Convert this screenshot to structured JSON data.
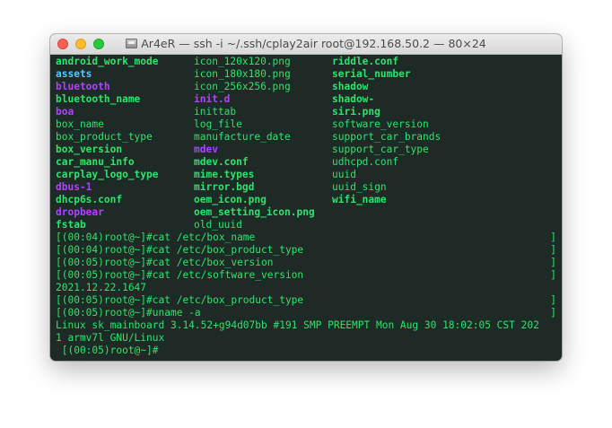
{
  "window": {
    "title": "Ar4eR — ssh -i ~/.ssh/cplay2air root@192.168.50.2 — 80×24",
    "title_icon": "disk-icon"
  },
  "colors": {
    "background": "#1d2a26",
    "text": "#2fe26b",
    "executable": "#56c6ff",
    "directory": "#b042ff"
  },
  "listing": [
    [
      {
        "text": "android_work_mode",
        "style": "bold green"
      },
      {
        "text": "icon_120x120.png",
        "style": "green"
      },
      {
        "text": "riddle.conf",
        "style": "bold green"
      }
    ],
    [
      {
        "text": "assets",
        "style": "bold cyan"
      },
      {
        "text": "icon_180x180.png",
        "style": "green"
      },
      {
        "text": "serial_number",
        "style": "bold green"
      }
    ],
    [
      {
        "text": "bluetooth",
        "style": "bold purple"
      },
      {
        "text": "icon_256x256.png",
        "style": "green"
      },
      {
        "text": "shadow",
        "style": "bold green"
      }
    ],
    [
      {
        "text": "bluetooth_name",
        "style": "bold green"
      },
      {
        "text": "init.d",
        "style": "bold purple"
      },
      {
        "text": "shadow-",
        "style": "bold green"
      }
    ],
    [
      {
        "text": "boa",
        "style": "bold purple"
      },
      {
        "text": "inittab",
        "style": "green"
      },
      {
        "text": "siri.png",
        "style": "bold green"
      }
    ],
    [
      {
        "text": "box_name",
        "style": "green"
      },
      {
        "text": "log_file",
        "style": "green"
      },
      {
        "text": "software_version",
        "style": "green"
      }
    ],
    [
      {
        "text": "box_product_type",
        "style": "green"
      },
      {
        "text": "manufacture_date",
        "style": "green"
      },
      {
        "text": "support_car_brands",
        "style": "green"
      }
    ],
    [
      {
        "text": "box_version",
        "style": "bold green"
      },
      {
        "text": "mdev",
        "style": "bold purple"
      },
      {
        "text": "support_car_type",
        "style": "green"
      }
    ],
    [
      {
        "text": "car_manu_info",
        "style": "bold green"
      },
      {
        "text": "mdev.conf",
        "style": "bold green"
      },
      {
        "text": "udhcpd.conf",
        "style": "green"
      }
    ],
    [
      {
        "text": "carplay_logo_type",
        "style": "bold green"
      },
      {
        "text": "mime.types",
        "style": "bold green"
      },
      {
        "text": "uuid",
        "style": "green"
      }
    ],
    [
      {
        "text": "dbus-1",
        "style": "bold purple"
      },
      {
        "text": "mirror.bgd",
        "style": "bold green"
      },
      {
        "text": "uuid_sign",
        "style": "green"
      }
    ],
    [
      {
        "text": "dhcp6s.conf",
        "style": "bold green"
      },
      {
        "text": "oem_icon.png",
        "style": "bold green"
      },
      {
        "text": "wifi_name",
        "style": "bold green"
      }
    ],
    [
      {
        "text": "dropbear",
        "style": "bold purple"
      },
      {
        "text": "oem_setting_icon.png",
        "style": "bold green"
      },
      {
        "text": "",
        "style": "green"
      }
    ],
    [
      {
        "text": "fstab",
        "style": "bold green"
      },
      {
        "text": "old_uuid",
        "style": "green"
      },
      {
        "text": "",
        "style": "green"
      }
    ]
  ],
  "session": [
    {
      "text": "[(00:04)root@~]#cat /etc/box_name",
      "end_bracket": "]"
    },
    {
      "text": "[(00:04)root@~]#cat /etc/box_product_type",
      "end_bracket": "]"
    },
    {
      "text": "[(00:05)root@~]#cat /etc/box_version",
      "end_bracket": "]"
    },
    {
      "text": "[(00:05)root@~]#cat /etc/software_version",
      "end_bracket": "]"
    },
    {
      "text": "2021.12.22.1647",
      "end_bracket": ""
    },
    {
      "text": "[(00:05)root@~]#cat /etc/box_product_type",
      "end_bracket": "]"
    },
    {
      "text": "[(00:05)root@~]#uname -a",
      "end_bracket": "]"
    },
    {
      "text": "Linux sk_mainboard 3.14.52+g94d07bb #191 SMP PREEMPT Mon Aug 30 18:02:05 CST 202",
      "end_bracket": ""
    },
    {
      "text": "1 armv7l GNU/Linux",
      "end_bracket": ""
    },
    {
      "text": " [(00:05)root@~]#",
      "end_bracket": ""
    }
  ]
}
